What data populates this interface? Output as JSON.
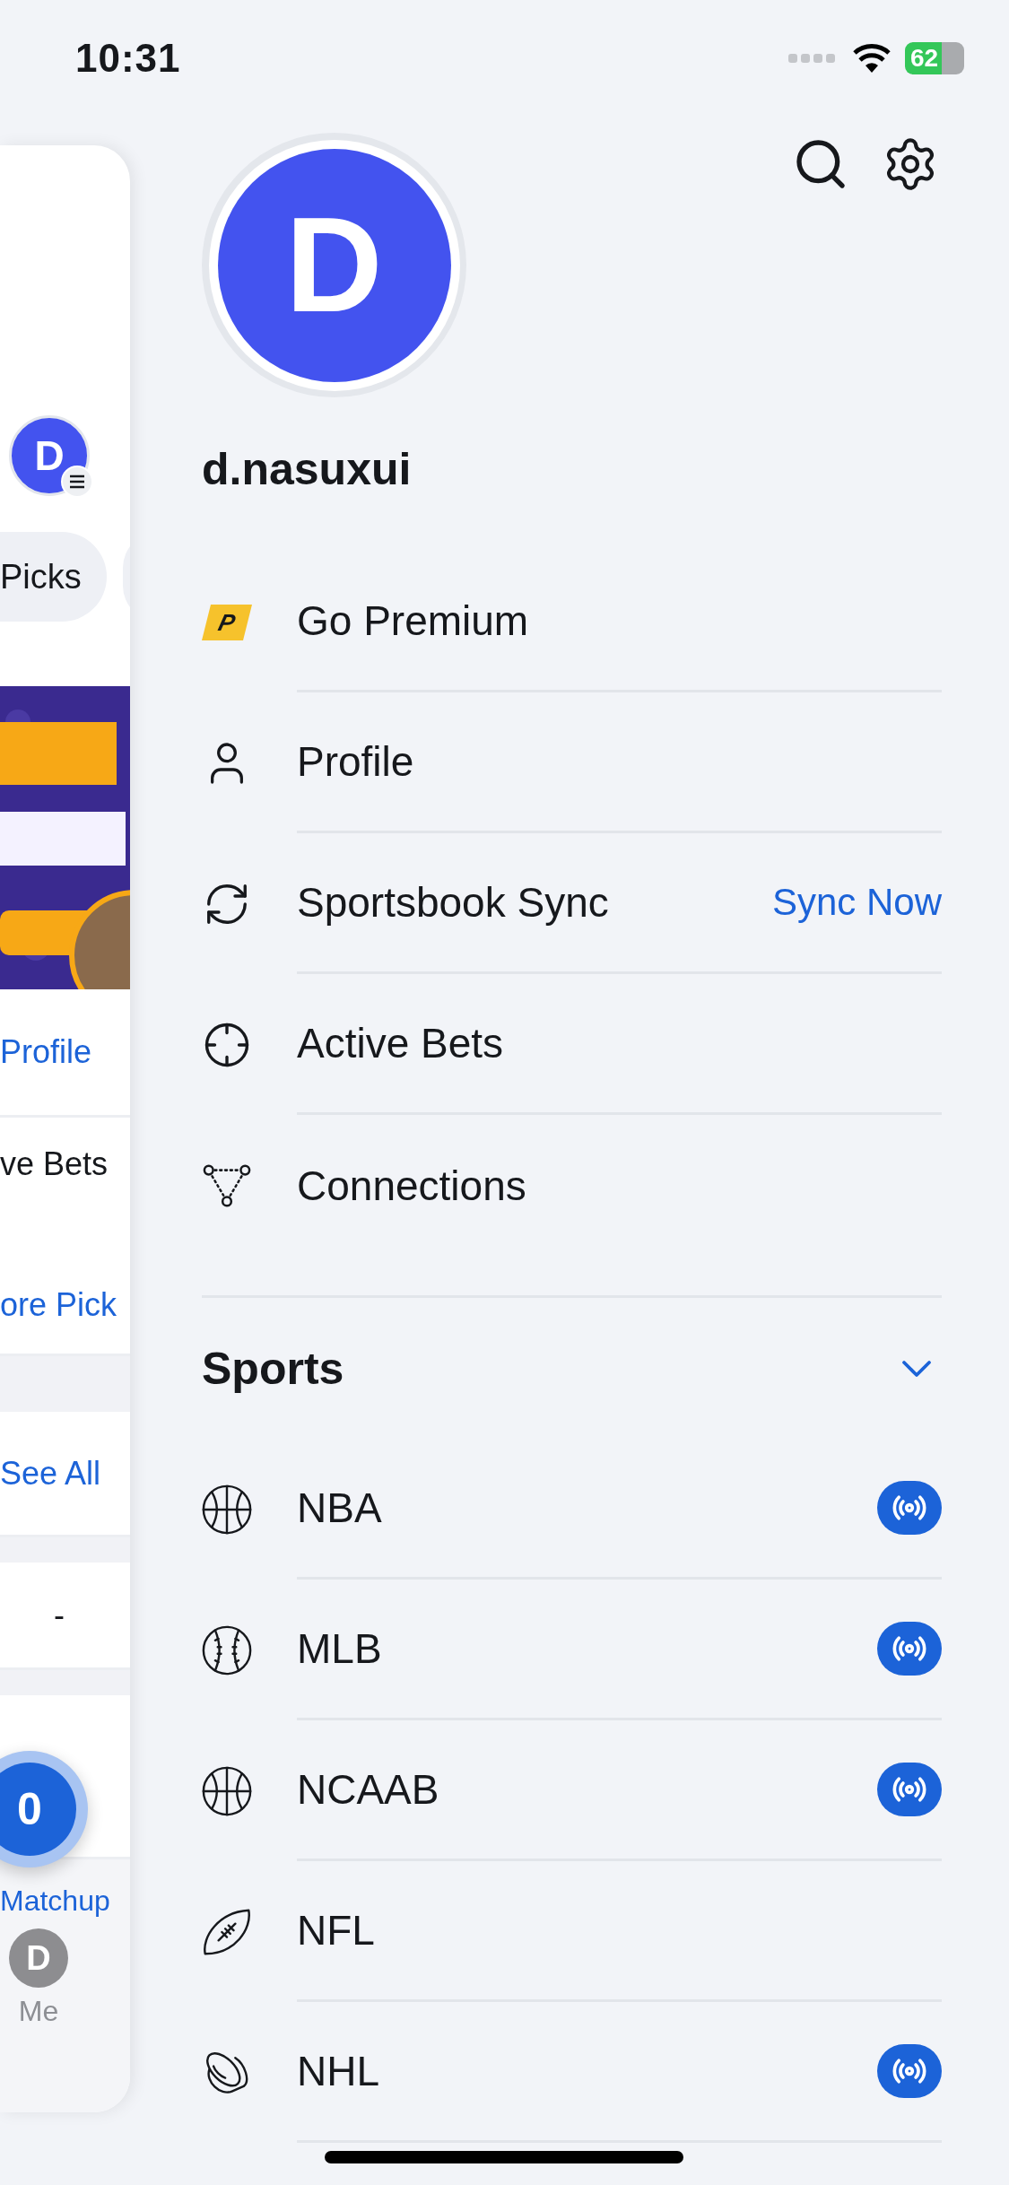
{
  "status_bar": {
    "time": "10:31",
    "battery": "62"
  },
  "behind_page": {
    "avatar_initial": "D",
    "chips": [
      {
        "label": "Picks"
      }
    ],
    "blocks": [
      {
        "items": [
          {
            "text": "Profile",
            "kind": "link"
          }
        ]
      },
      {
        "items": [
          {
            "text": "ve Bets",
            "kind": "plain"
          },
          {
            "text": "ore Pick",
            "kind": "link"
          }
        ]
      },
      {
        "items": [
          {
            "text": "See All",
            "kind": "link"
          }
        ]
      },
      {
        "items": [
          {
            "text": "-",
            "kind": "value"
          }
        ]
      },
      {
        "kind": "empty"
      }
    ],
    "fab": {
      "count": "0"
    },
    "tab_bar": [
      {
        "label": "Matchup",
        "kind": "text",
        "selected": true
      },
      {
        "label": "Me",
        "kind": "avatar",
        "initial": "D",
        "selected": false
      }
    ]
  },
  "drawer": {
    "avatar_initial": "D",
    "username": "d.nasuxui",
    "menu": [
      {
        "label": "Go Premium",
        "kind": "premium",
        "badge": "P"
      },
      {
        "label": "Profile",
        "kind": "profile"
      },
      {
        "label": "Sportsbook Sync",
        "kind": "sync",
        "action": "Sync Now"
      },
      {
        "label": "Active Bets",
        "kind": "bets"
      },
      {
        "label": "Connections",
        "kind": "connections"
      }
    ],
    "sports": {
      "title": "Sports",
      "expanded": true,
      "items": [
        {
          "label": "NBA",
          "kind": "basketball",
          "live": true
        },
        {
          "label": "MLB",
          "kind": "baseball",
          "live": true
        },
        {
          "label": "NCAAB",
          "kind": "basketball",
          "live": true
        },
        {
          "label": "NFL",
          "kind": "football",
          "live": false
        },
        {
          "label": "NHL",
          "kind": "hockey",
          "live": true
        }
      ]
    }
  }
}
